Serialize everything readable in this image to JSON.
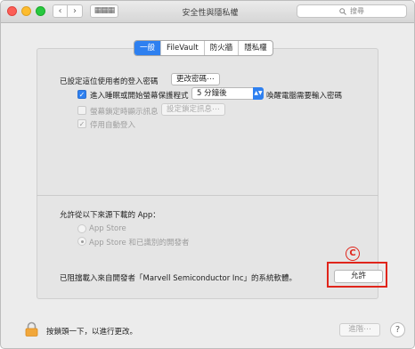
{
  "window": {
    "title": "安全性與隱私權",
    "search_placeholder": "搜尋",
    "search_icon": "search-icon",
    "grid_glyph": "▦▦▦"
  },
  "tabs": [
    {
      "label": "一般",
      "active": true
    },
    {
      "label": "FileVault",
      "active": false
    },
    {
      "label": "防火牆",
      "active": false
    },
    {
      "label": "隱私權",
      "active": false
    }
  ],
  "general": {
    "login_password_label": "已設定這位使用者的登入密碼",
    "change_password_button": "更改密碼⋯",
    "require_password": {
      "checked": true,
      "label_before": "進入睡眠或開始螢幕保護程式",
      "selected_option": "5 分鐘後",
      "label_after": "喚醒電腦需要輸入密碼"
    },
    "show_message": {
      "checked": false,
      "enabled": false,
      "label": "螢幕鎖定時顯示訊息",
      "button": "設定鎖定訊息⋯"
    },
    "auto_login": {
      "checked": true,
      "enabled": false,
      "label": "停用自動登入"
    }
  },
  "allow_apps": {
    "heading": "允許從以下來源下載的 App：",
    "options": [
      {
        "label": "App Store",
        "selected": false
      },
      {
        "label": "App Store 和已識別的開發者",
        "selected": true
      }
    ],
    "blocked_message": "已阻擋載入來自開發者「Marvell Semiconductor Inc」的系統軟體。",
    "allow_button": "允許"
  },
  "annotation": {
    "marker": "C",
    "color": "#e0251b"
  },
  "footer": {
    "lock_text": "按鎖頭一下，以進行更改。",
    "advanced_button": "進階⋯",
    "help_glyph": "?"
  },
  "colors": {
    "accent": "#2e80f0",
    "highlight": "#e0251b"
  }
}
